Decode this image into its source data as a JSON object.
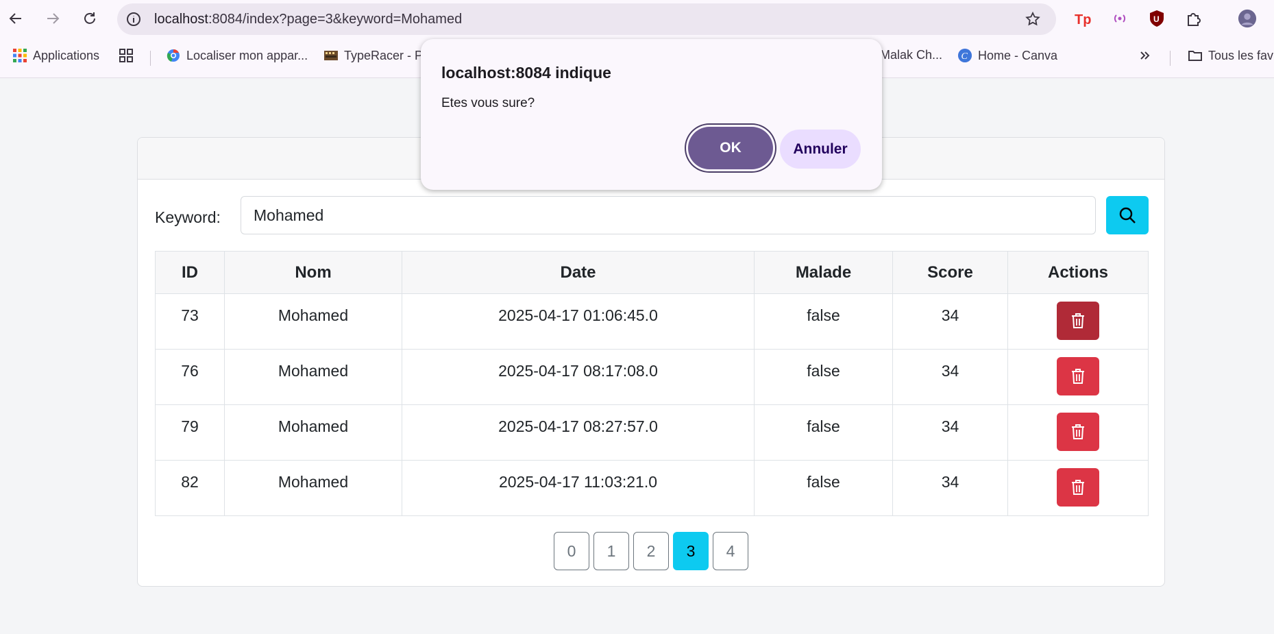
{
  "browser": {
    "url_host": "localhost",
    "url_rest": ":8084/index?page=3&keyword=Mohamed",
    "bookmarks": [
      {
        "label": "Applications"
      },
      {
        "label": "Localiser mon appar..."
      },
      {
        "label": "TypeRacer - P"
      },
      {
        "label": "Malak Ch..."
      },
      {
        "label": "Home - Canva"
      },
      {
        "label": "Tous les fav"
      }
    ]
  },
  "dialog": {
    "title": "localhost:8084 indique",
    "message": "Etes vous sure?",
    "ok_label": "OK",
    "cancel_label": "Annuler"
  },
  "search": {
    "label": "Keyword:",
    "value": "Mohamed"
  },
  "table": {
    "headers": [
      "ID",
      "Nom",
      "Date",
      "Malade",
      "Score",
      "Actions"
    ],
    "rows": [
      {
        "id": "73",
        "nom": "Mohamed",
        "date": "2025-04-17 01:06:45.0",
        "malade": "false",
        "score": "34"
      },
      {
        "id": "76",
        "nom": "Mohamed",
        "date": "2025-04-17 08:17:08.0",
        "malade": "false",
        "score": "34"
      },
      {
        "id": "79",
        "nom": "Mohamed",
        "date": "2025-04-17 08:27:57.0",
        "malade": "false",
        "score": "34"
      },
      {
        "id": "82",
        "nom": "Mohamed",
        "date": "2025-04-17 11:03:21.0",
        "malade": "false",
        "score": "34"
      }
    ]
  },
  "pagination": {
    "pages": [
      "0",
      "1",
      "2",
      "3",
      "4"
    ],
    "current": "3"
  },
  "colors": {
    "info": "#0dcaf0",
    "danger": "#dc3545",
    "dialog_primary": "#6d5a92",
    "dialog_secondary": "#eaddff"
  }
}
